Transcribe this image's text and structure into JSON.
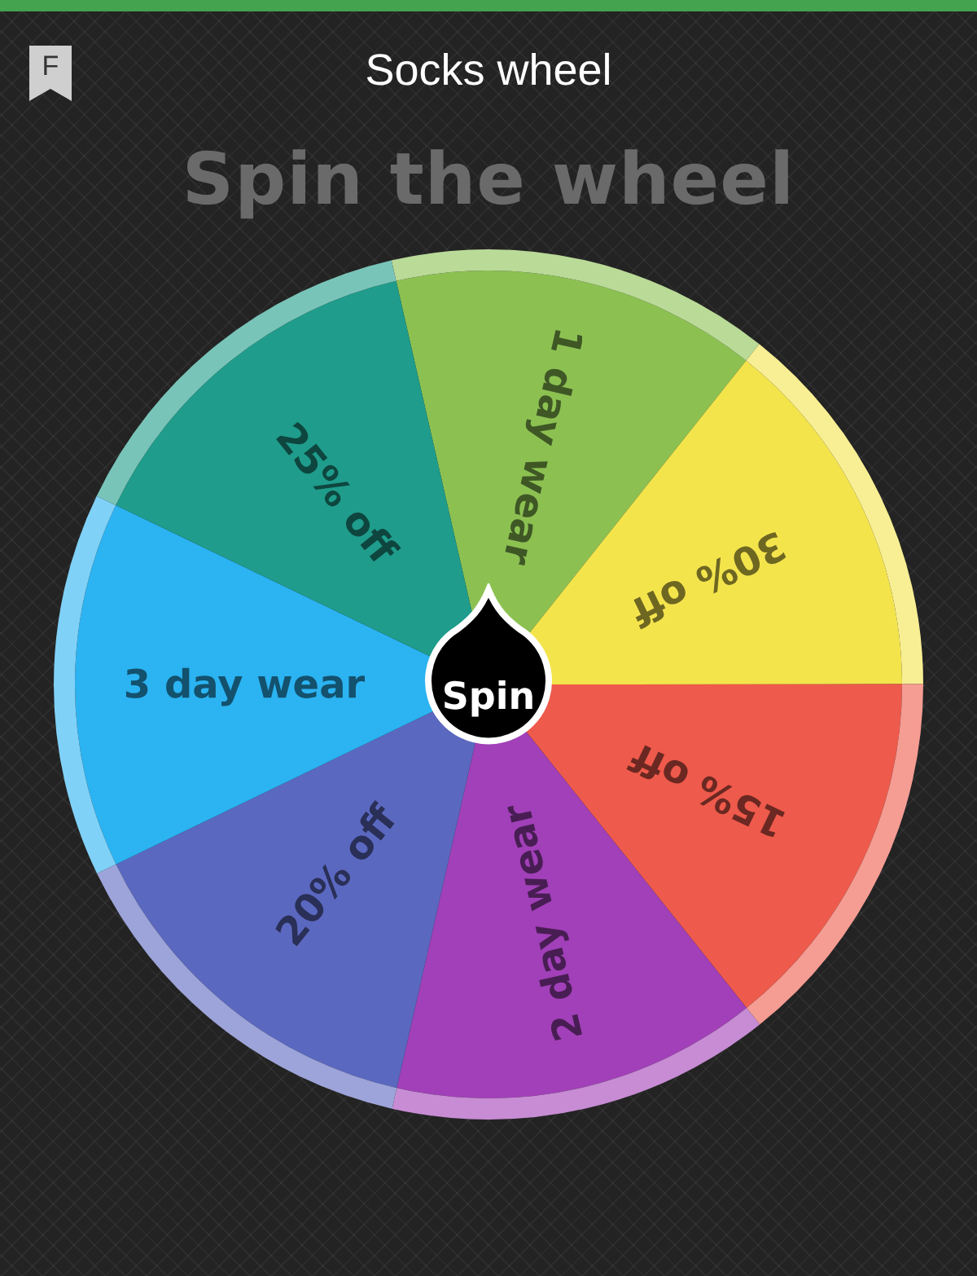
{
  "header": {
    "badge": "F",
    "title": "Socks wheel"
  },
  "heading": "Spin the wheel",
  "wheel": {
    "segments": [
      {
        "label": "1 day wear",
        "color": "#8cc152"
      },
      {
        "label": "30% off",
        "color": "#f4e44c"
      },
      {
        "label": "15% off",
        "color": "#ee5a4b"
      },
      {
        "label": "2 day wear",
        "color": "#a140b8"
      },
      {
        "label": "20% off",
        "color": "#5b68c0"
      },
      {
        "label": "3 day wear",
        "color": "#2bb3f2"
      },
      {
        "label": "25% off",
        "color": "#1f9c8b"
      }
    ],
    "button": "Spin"
  }
}
